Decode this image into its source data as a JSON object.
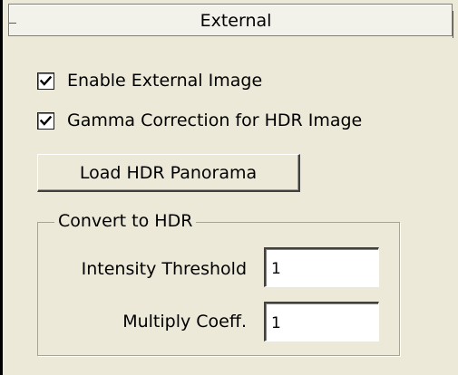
{
  "panel": {
    "title": "External"
  },
  "options": {
    "enable_external_image": {
      "label": "Enable External Image",
      "checked": true
    },
    "gamma_correction": {
      "label": "Gamma Correction for HDR Image",
      "checked": true
    }
  },
  "buttons": {
    "load_hdr_label": "Load HDR Panorama"
  },
  "convert_group": {
    "title": "Convert to HDR",
    "intensity_threshold": {
      "label": "Intensity Threshold",
      "value": "1"
    },
    "multiply_coeff": {
      "label": "Multiply Coeff.",
      "value": "1"
    }
  },
  "colors": {
    "panel_background": "#ece9d8",
    "header_background": "#f3f2ea",
    "field_background": "#ffffff"
  }
}
